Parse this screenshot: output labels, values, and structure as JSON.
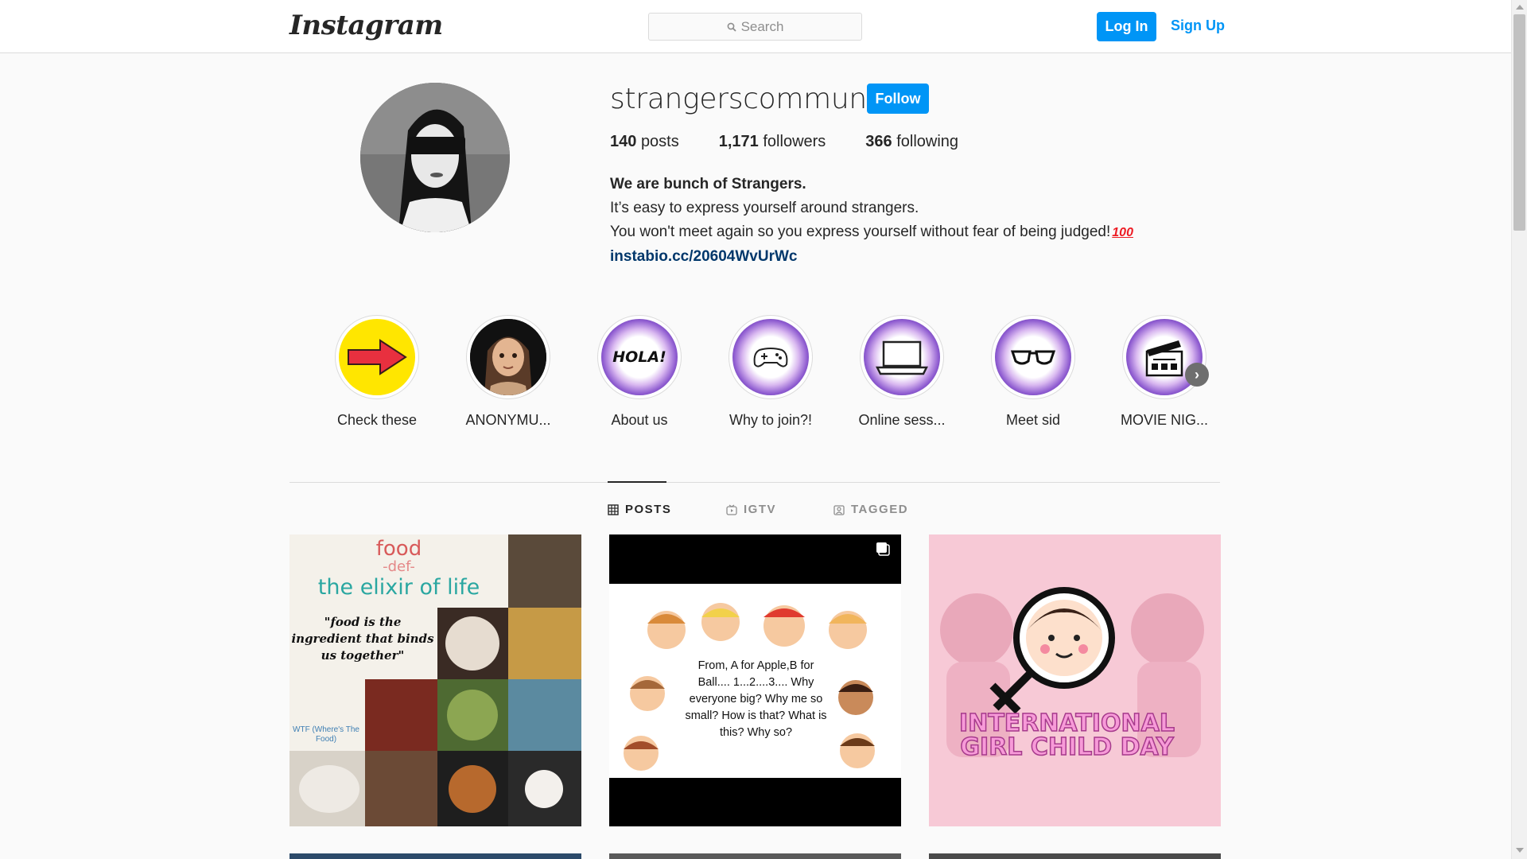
{
  "header": {
    "logo_text": "Instagram",
    "search_placeholder": "Search",
    "login_label": "Log In",
    "signup_label": "Sign Up"
  },
  "profile": {
    "username": "strangerscommunity",
    "follow_label": "Follow",
    "stats": {
      "posts_count": "140",
      "posts_label": "posts",
      "followers_count": "1,171",
      "followers_label": "followers",
      "following_count": "366",
      "following_label": "following"
    },
    "bio": {
      "title": "We are bunch of Strangers.",
      "line1": "It’s easy to express yourself around strangers.",
      "line2": "You won't meet again so you express yourself without fear of being judged!",
      "emoji": "100",
      "link": "instabio.cc/20604WvUrWc"
    }
  },
  "highlights": [
    {
      "label": "Check these",
      "icon": "red-arrow-icon"
    },
    {
      "label": "ANONYMU...",
      "icon": "avatar-girl-icon"
    },
    {
      "label": "About us",
      "icon": "hola-text",
      "text": "HOLA!"
    },
    {
      "label": "Why to join?!",
      "icon": "gamepad-icon"
    },
    {
      "label": "Online sess...",
      "icon": "laptop-icon"
    },
    {
      "label": "Meet sid",
      "icon": "glasses-icon"
    },
    {
      "label": "MOVIE NIG...",
      "icon": "clapperboard-icon"
    }
  ],
  "tabs": [
    {
      "label": "POSTS",
      "icon": "grid-icon",
      "active": true
    },
    {
      "label": "IGTV",
      "icon": "igtv-icon",
      "active": false
    },
    {
      "label": "TAGGED",
      "icon": "tagged-icon",
      "active": false
    }
  ],
  "posts": {
    "post1": {
      "title_line1": "food",
      "title_line2": "-def-",
      "title_line3": "the elixir of life",
      "quote": "\"food is the ingredient that binds us together\"",
      "watermark": "WTF (Where's The Food)"
    },
    "post2": {
      "text": "From, A for Apple,B for Ball.... 1...2....3.... Why everyone big? Why me so small? How is that? What is this? Why so?",
      "icon": "multiple-posts-icon"
    },
    "post3": {
      "text_line1": "INTERNATIONAL",
      "text_line2": "GIRL CHILD DAY"
    }
  },
  "colors": {
    "accent": "#0095f6",
    "link": "#00376b",
    "background": "#fafafa"
  }
}
